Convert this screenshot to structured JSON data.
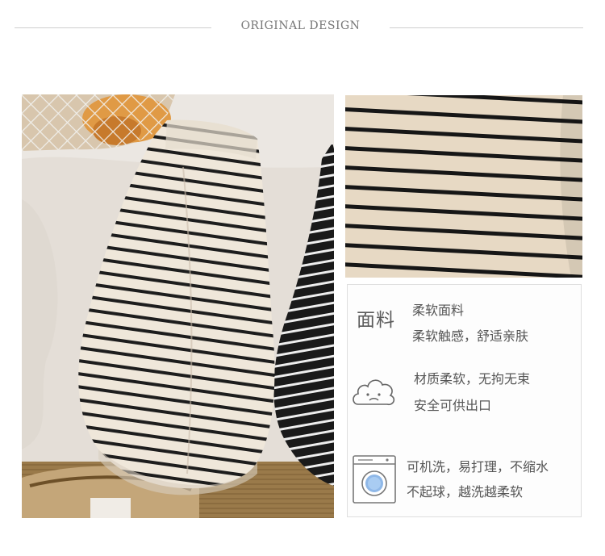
{
  "header": {
    "title": "ORIGINAL DESIGN"
  },
  "features": {
    "fabric": {
      "badge": "面料",
      "line1": "柔软面料",
      "line2": "柔软触感，舒适亲肤"
    },
    "soft": {
      "line1": "材质柔软，无拘无束",
      "line2": "安全可供出口"
    },
    "wash": {
      "line1": "可机洗，易打理，不缩水",
      "line2": "不起球，越洗越柔软"
    }
  },
  "icons": {
    "cloud": "cloud-face-icon",
    "washer": "washing-machine-icon"
  }
}
